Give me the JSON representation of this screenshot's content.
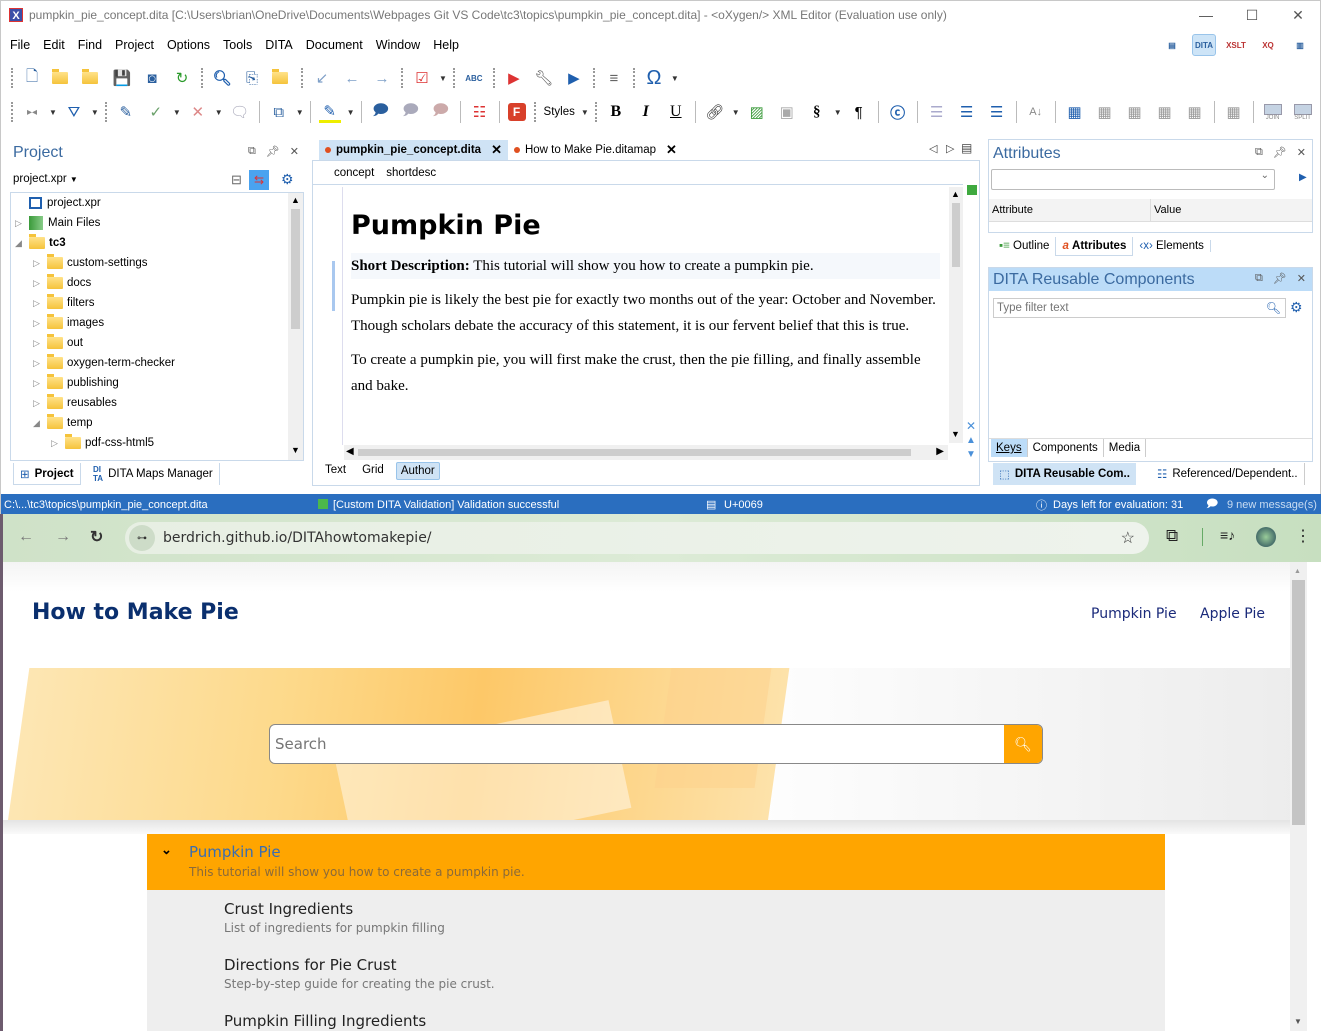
{
  "window": {
    "title": "pumpkin_pie_concept.dita [C:\\Users\\brian\\OneDrive\\Documents\\Webpages Git VS Code\\tc3\\topics\\pumpkin_pie_concept.dita] - <oXygen/> XML Editor (Evaluation use only)",
    "minimize": "—",
    "maximize": "☐",
    "close": "✕"
  },
  "menu": [
    "File",
    "Edit",
    "Find",
    "Project",
    "Options",
    "Tools",
    "DITA",
    "Document",
    "Window",
    "Help"
  ],
  "perspectives": [
    {
      "name": "editor",
      "label": "▤"
    },
    {
      "name": "dita",
      "label": "DITA"
    },
    {
      "name": "xslt-debugger",
      "label": "XSLT"
    },
    {
      "name": "xquery-debugger",
      "label": "XQ"
    },
    {
      "name": "database",
      "label": "▥"
    }
  ],
  "toolbar": {
    "styles_label": "Styles",
    "bold": "B",
    "italic": "I",
    "underline": "U",
    "omega": "Ω",
    "section": "§",
    "pilcrow": "¶",
    "join": "JOIN",
    "split": "SPLIT",
    "spell": "ABC"
  },
  "project": {
    "title": "Project",
    "selector": "project.xpr",
    "tree": [
      {
        "label": "project.xpr",
        "level": 0,
        "arrow": "",
        "kind": "project"
      },
      {
        "label": "Main Files",
        "level": 0,
        "arrow": "▷",
        "kind": "main"
      },
      {
        "label": "tc3",
        "level": 0,
        "arrow": "◢",
        "kind": "folder",
        "bold": true
      },
      {
        "label": "custom-settings",
        "level": 1,
        "arrow": "▷",
        "kind": "folder"
      },
      {
        "label": "docs",
        "level": 1,
        "arrow": "▷",
        "kind": "folder"
      },
      {
        "label": "filters",
        "level": 1,
        "arrow": "▷",
        "kind": "folder"
      },
      {
        "label": "images",
        "level": 1,
        "arrow": "▷",
        "kind": "folder"
      },
      {
        "label": "out",
        "level": 1,
        "arrow": "▷",
        "kind": "folder"
      },
      {
        "label": "oxygen-term-checker",
        "level": 1,
        "arrow": "▷",
        "kind": "folder"
      },
      {
        "label": "publishing",
        "level": 1,
        "arrow": "▷",
        "kind": "folder"
      },
      {
        "label": "reusables",
        "level": 1,
        "arrow": "▷",
        "kind": "folder"
      },
      {
        "label": "temp",
        "level": 1,
        "arrow": "◢",
        "kind": "folder"
      },
      {
        "label": "pdf-css-html5",
        "level": 2,
        "arrow": "▷",
        "kind": "folder"
      }
    ],
    "bottom_tabs": [
      "Project",
      "DITA Maps Manager"
    ]
  },
  "editor": {
    "tabs": [
      {
        "label": "pumpkin_pie_concept.dita",
        "active": true
      },
      {
        "label": "How to Make Pie.ditamap",
        "active": false
      }
    ],
    "breadcrumb": [
      "concept",
      "shortdesc"
    ],
    "heading": "Pumpkin Pie",
    "shortdesc_label": "Short Description:",
    "shortdesc_text": " This tutorial will show you how to create a pumpkin pie.",
    "paragraphs": [
      "Pumpkin pie is likely the best pie for exactly two months out of the year: October and November. Though scholars debate the accuracy of this statement, it is our fervent belief that this is true.",
      "To create a pumpkin pie, you will first make the crust, then the pie filling, and finally assemble and bake."
    ],
    "modes": [
      "Text",
      "Grid",
      "Author"
    ],
    "active_mode": "Author"
  },
  "attributes": {
    "title": "Attributes",
    "col_attribute": "Attribute",
    "col_value": "Value",
    "tabs": [
      "Outline",
      "Attributes",
      "Elements"
    ]
  },
  "reusable": {
    "title": "DITA Reusable Components",
    "filter_placeholder": "Type filter text",
    "tabs": [
      "Keys",
      "Components",
      "Media"
    ],
    "bottom_tabs": [
      "DITA Reusable Com..",
      "Referenced/Dependent.."
    ]
  },
  "statusbar": {
    "path": "C:\\...\\tc3\\topics\\pumpkin_pie_concept.dita",
    "validation": "[Custom DITA Validation] Validation successful",
    "unicode": "U+0069",
    "evaluation": "Days left for evaluation: 31",
    "messages": "9 new message(s)"
  },
  "browser": {
    "url": "berdrich.github.io/DITAhowtomakepie/"
  },
  "site": {
    "title": "How to Make Pie",
    "nav": [
      "Pumpkin Pie",
      "Apple Pie"
    ],
    "search_placeholder": "Search",
    "toc": {
      "title": "Pumpkin Pie",
      "desc": "This tutorial will show you how to create a pumpkin pie.",
      "children": [
        {
          "title": "Crust Ingredients",
          "desc": "List of ingredients for pumpkin filling"
        },
        {
          "title": "Directions for Pie Crust",
          "desc": "Step-by-step guide for creating the pie crust."
        },
        {
          "title": "Pumpkin Filling Ingredients",
          "desc": ""
        }
      ]
    },
    "accent": "#ffa500",
    "title_color": "#0a2f6e"
  }
}
